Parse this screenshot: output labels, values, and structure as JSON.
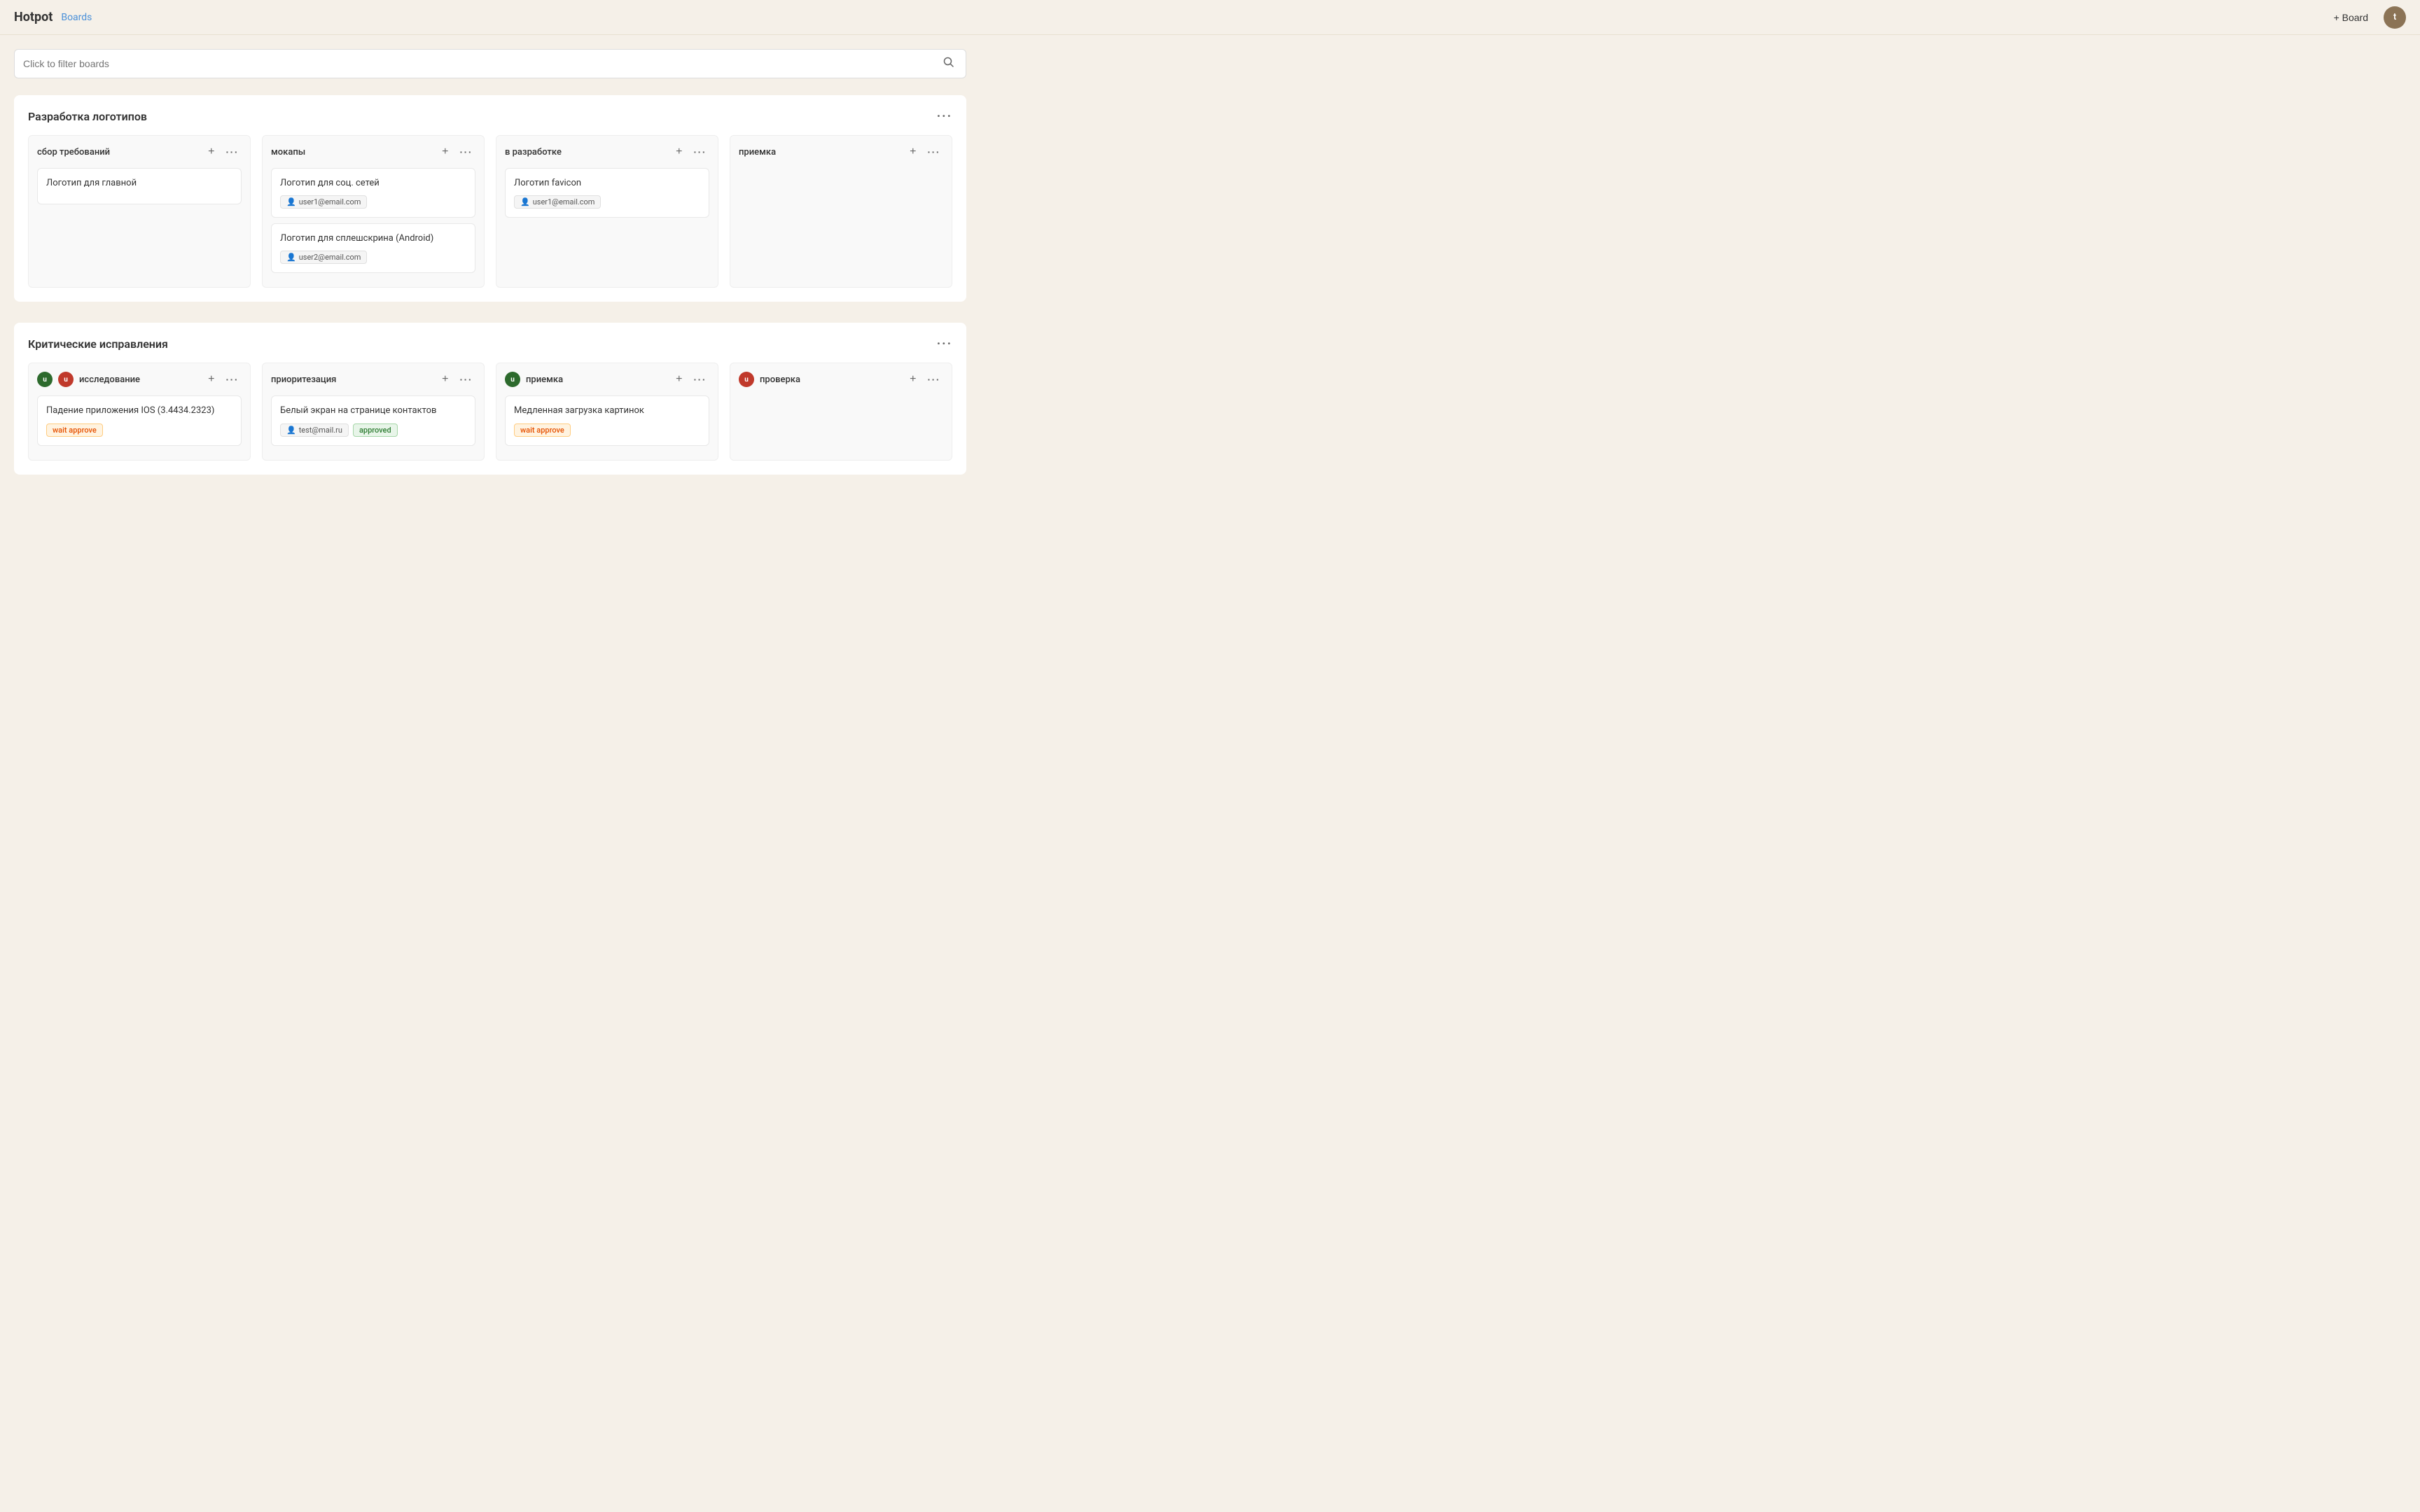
{
  "header": {
    "logo": "Hotpot",
    "breadcrumb": "Boards",
    "add_board_label": "+ Board",
    "avatar_letter": "t"
  },
  "search": {
    "placeholder": "Click to filter boards"
  },
  "sections": [
    {
      "id": "section-logos",
      "title": "Разработка логотипов",
      "columns": [
        {
          "id": "col-requirements",
          "title": "сбор требований",
          "avatars": [],
          "cards": [
            {
              "id": "card-1",
              "title": "Логотип для главной",
              "assignees": [],
              "badges": []
            }
          ]
        },
        {
          "id": "col-mockups",
          "title": "мокапы",
          "avatars": [],
          "cards": [
            {
              "id": "card-2",
              "title": "Логотип для соц. сетей",
              "assignees": [
                "user1@email.com"
              ],
              "badges": []
            },
            {
              "id": "card-3",
              "title": "Логотип для сплешскрина (Android)",
              "assignees": [
                "user2@email.com"
              ],
              "badges": []
            }
          ]
        },
        {
          "id": "col-inprogress",
          "title": "в разработке",
          "avatars": [],
          "cards": [
            {
              "id": "card-4",
              "title": "Логотип favicon",
              "assignees": [
                "user1@email.com"
              ],
              "badges": []
            }
          ]
        },
        {
          "id": "col-acceptance",
          "title": "приемка",
          "avatars": [],
          "cards": []
        }
      ]
    },
    {
      "id": "section-bugs",
      "title": "Критические исправления",
      "columns": [
        {
          "id": "col-research",
          "title": "исследование",
          "avatars": [
            {
              "letter": "u",
              "color": "green"
            },
            {
              "letter": "u",
              "color": "red"
            }
          ],
          "cards": [
            {
              "id": "card-5",
              "title": "Падение приложения IOS (3.4434.2323)",
              "assignees": [],
              "badges": [
                {
                  "text": "wait approve",
                  "type": "wait"
                }
              ]
            }
          ]
        },
        {
          "id": "col-prioritization",
          "title": "приоритезация",
          "avatars": [],
          "cards": [
            {
              "id": "card-6",
              "title": "Белый экран на странице контактов",
              "assignees": [
                "test@mail.ru"
              ],
              "badges": [
                {
                  "text": "approved",
                  "type": "approved"
                }
              ]
            }
          ]
        },
        {
          "id": "col-acceptance2",
          "title": "приемка",
          "avatars": [
            {
              "letter": "u",
              "color": "green"
            }
          ],
          "cards": [
            {
              "id": "card-7",
              "title": "Медленная загрузка картинок",
              "assignees": [],
              "badges": [
                {
                  "text": "wait approve",
                  "type": "wait"
                }
              ]
            }
          ]
        },
        {
          "id": "col-review",
          "title": "проверка",
          "avatars": [
            {
              "letter": "u",
              "color": "red"
            }
          ],
          "cards": []
        }
      ]
    }
  ]
}
